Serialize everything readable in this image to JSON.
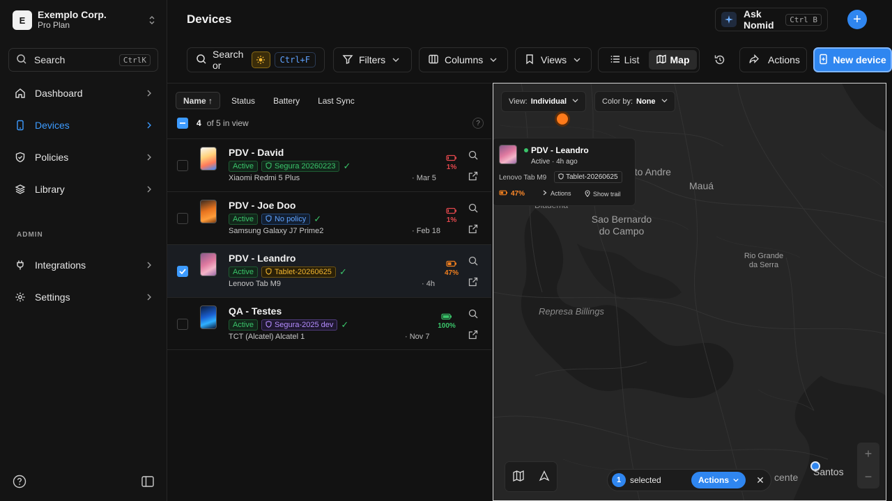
{
  "org": {
    "initial": "E",
    "name": "Exemplo Corp.",
    "plan": "Pro Plan"
  },
  "sidebar": {
    "search_label": "Search",
    "search_shortcut": "CtrlK",
    "items": [
      {
        "label": "Dashboard",
        "icon": "home-icon"
      },
      {
        "label": "Devices",
        "icon": "phone-icon",
        "active": true
      },
      {
        "label": "Policies",
        "icon": "shield-icon"
      },
      {
        "label": "Library",
        "icon": "layers-icon"
      }
    ],
    "admin_label": "ADMIN",
    "admin_items": [
      {
        "label": "Integrations",
        "icon": "plug-icon"
      },
      {
        "label": "Settings",
        "icon": "gear-icon"
      }
    ]
  },
  "header": {
    "title": "Devices",
    "ask_label": "Ask Nomid",
    "ask_shortcut": "Ctrl B",
    "add_label": "+"
  },
  "toolbar": {
    "search_label": "Search or",
    "search_shortcut": "Ctrl+F",
    "filters_label": "Filters",
    "columns_label": "Columns",
    "views_label": "Views",
    "list_label": "List",
    "map_label": "Map",
    "actions_label": "Actions",
    "new_device_label": "New device"
  },
  "list": {
    "sort_tabs": [
      "Name ↑",
      "Status",
      "Battery",
      "Last Sync"
    ],
    "selected_count": "4",
    "in_view_text": "of 5 in view",
    "help": "?",
    "rows": [
      {
        "name": "PDV - David",
        "status": "Active",
        "policy": "Segura 20260223",
        "model": "Xiaomi Redmi 5 Plus",
        "date": "· Mar 5",
        "battery": "1%",
        "checked": false
      },
      {
        "name": "PDV - Joe Doo",
        "status": "Active",
        "policy": "No policy",
        "model": "Samsung Galaxy J7 Prime2",
        "date": "· Feb 18",
        "battery": "1%",
        "checked": false
      },
      {
        "name": "PDV - Leandro",
        "status": "Active",
        "policy": "Tablet-20260625",
        "model": "Lenovo Tab M9",
        "date": "· 4h",
        "battery": "47%",
        "checked": true
      },
      {
        "name": "QA - Testes",
        "status": "Active",
        "policy": "Segura-2025 dev",
        "model": "TCT (Alcatel) Alcatel 1",
        "date": "· Nov 7",
        "battery": "100%",
        "checked": false
      }
    ],
    "colors": {
      "battery_low": "#e5484d",
      "battery_mid": "#f2801f",
      "battery_full": "#3ac46a"
    }
  },
  "map": {
    "view_label": "View:",
    "view_value": "Individual",
    "color_label": "Color by:",
    "color_value": "None",
    "popup": {
      "name": "PDV - Leandro",
      "status": "Active · 4h ago",
      "model": "Lenovo Tab M9",
      "policy": "Tablet-20260625",
      "battery": "47%",
      "actions": "Actions",
      "trail": "Show trail"
    },
    "labels": {
      "santo_andre": "nto Andre",
      "maua": "Mauá",
      "diadema": "Diadema",
      "sbc_line1": "Sao Bernardo",
      "sbc_line2": "do Campo",
      "rio_line1": "Rio Grande",
      "rio_line2": "da Serra",
      "represa": "Represa Billings",
      "santos": "Santos",
      "vicente": "cente"
    },
    "selection": {
      "count": "1",
      "text": "selected",
      "actions": "Actions",
      "close": "✕"
    },
    "zoom_in": "+",
    "zoom_out": "−"
  }
}
